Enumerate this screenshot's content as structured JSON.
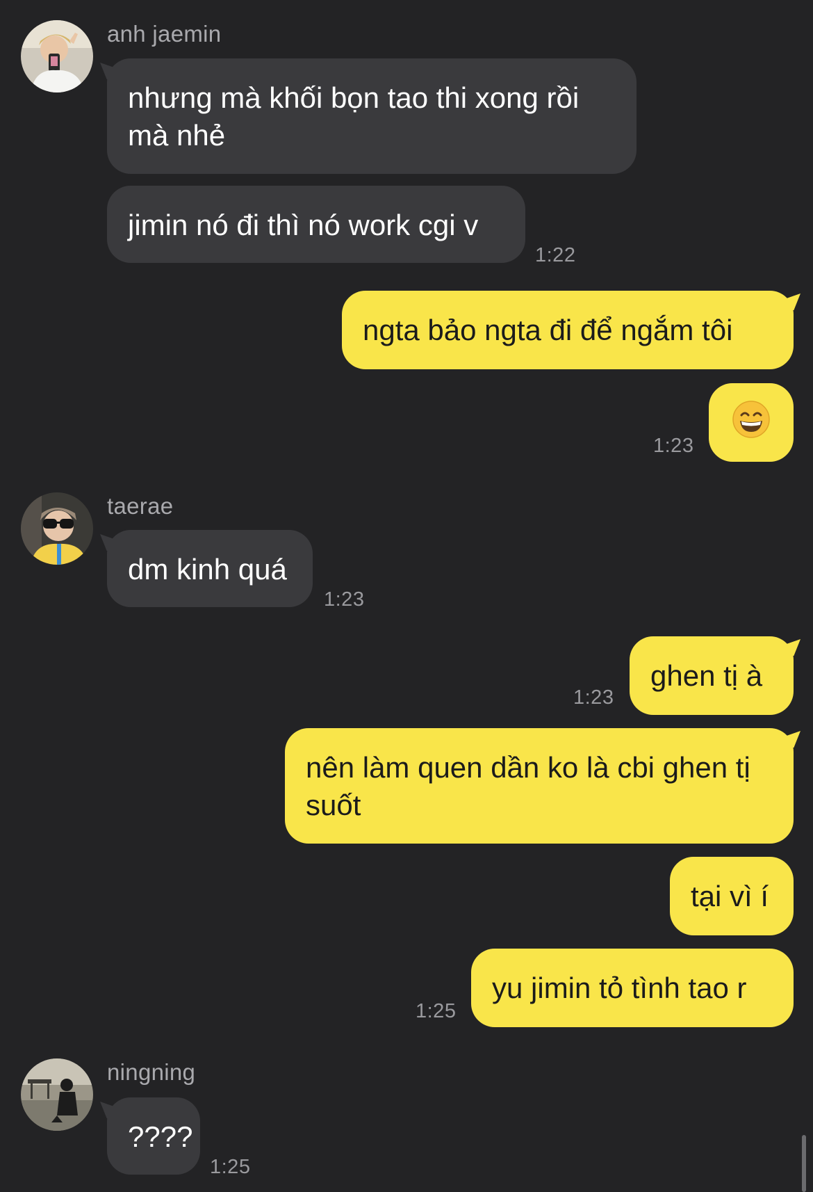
{
  "messages": {
    "m1": {
      "sender": "anh jaemin",
      "text": "nhưng mà khối bọn tao thi xong rồi mà nhẻ"
    },
    "m2": {
      "text": "jimin nó đi thì nó work cgi v",
      "time": "1:22"
    },
    "m3": {
      "text": "ngta bảo ngta đi để ngắm tôi"
    },
    "m4": {
      "emoji": "grinning-face-with-smiling-eyes",
      "time": "1:23"
    },
    "m5": {
      "sender": "taerae",
      "text": "dm kinh quá",
      "time": "1:23"
    },
    "m6": {
      "text": "ghen tị à",
      "time": "1:23"
    },
    "m7": {
      "text": "nên làm quen dần ko là cbi ghen tị suốt"
    },
    "m8": {
      "text": "tại vì í"
    },
    "m9": {
      "text": "yu jimin tỏ tình tao r",
      "time": "1:25"
    },
    "m10": {
      "sender": "ningning",
      "text": "????",
      "time": "1:25"
    }
  },
  "colors": {
    "background": "#232325",
    "incoming_bubble": "#3a3a3d",
    "outgoing_bubble": "#f9e54a",
    "timestamp": "#9a9a9e"
  }
}
